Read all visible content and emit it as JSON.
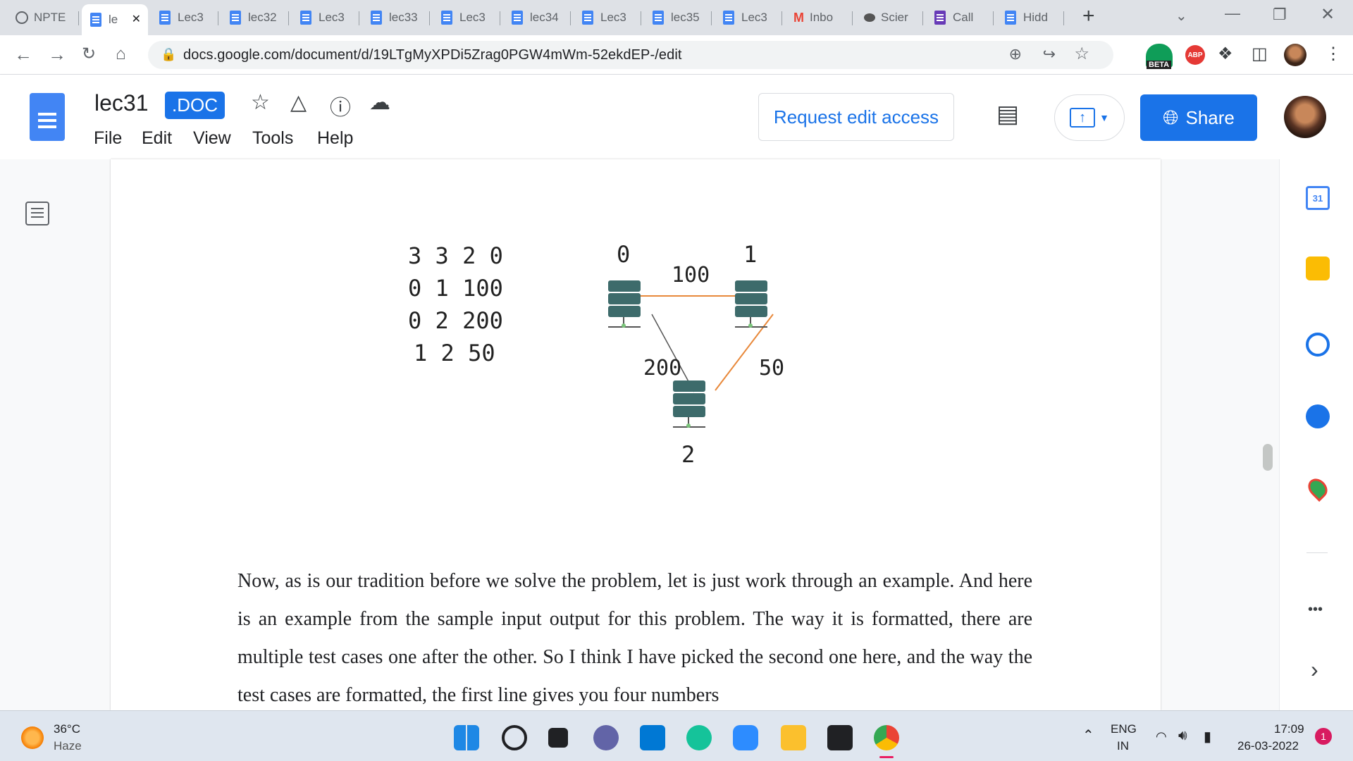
{
  "browser": {
    "tabs": [
      {
        "label": "NPTE",
        "icon": "globe-icon"
      },
      {
        "label": "le",
        "icon": "docs-icon",
        "active": true
      },
      {
        "label": "Lec3",
        "icon": "docs-icon"
      },
      {
        "label": "lec32",
        "icon": "docs-icon"
      },
      {
        "label": "Lec3",
        "icon": "docs-icon"
      },
      {
        "label": "lec33",
        "icon": "docs-icon"
      },
      {
        "label": "Lec3",
        "icon": "docs-icon"
      },
      {
        "label": "lec34",
        "icon": "docs-icon"
      },
      {
        "label": "Lec3",
        "icon": "docs-icon"
      },
      {
        "label": "lec35",
        "icon": "docs-icon"
      },
      {
        "label": "Lec3",
        "icon": "docs-icon"
      },
      {
        "label": "Inbo",
        "icon": "gmail-icon"
      },
      {
        "label": "Scier",
        "icon": "science-icon"
      },
      {
        "label": "Call",
        "icon": "forms-icon"
      },
      {
        "label": "Hidd",
        "icon": "docs-icon"
      }
    ],
    "new_tab": "+",
    "url": "docs.google.com/document/d/19LTgMyXPDi5Zrag0PGW4mWm-52ekdEP-/edit",
    "beta_label": "BETA",
    "abp_label": "ABP"
  },
  "docs": {
    "title": "lec31",
    "badge": ".DOC",
    "menu": [
      "File",
      "Edit",
      "View",
      "Tools",
      "Help"
    ],
    "request_edit": "Request edit access",
    "share": "Share"
  },
  "figure": {
    "input_lines": [
      "3 3 2 0",
      "0 1 100",
      "0 2 200",
      "1 2 50"
    ],
    "nodes": [
      {
        "id": "0",
        "label": "0"
      },
      {
        "id": "1",
        "label": "1"
      },
      {
        "id": "2",
        "label": "2"
      }
    ],
    "edges": [
      {
        "from": "0",
        "to": "1",
        "weight": "100",
        "color": "#e8883a"
      },
      {
        "from": "0",
        "to": "2",
        "weight": "200",
        "color": "#555555"
      },
      {
        "from": "1",
        "to": "2",
        "weight": "50",
        "color": "#e8883a"
      }
    ]
  },
  "paragraph": "Now, as is our tradition before we solve the problem, let is just work through an example. And here is an example from the sample input output for this problem. The way it is formatted, there are multiple test cases one after the other. So I think I have picked the second one here, and the way the test cases are formatted, the first line gives you four numbers",
  "side_panel": {
    "calendar_day": "31",
    "more": "•••",
    "expand": "›"
  },
  "taskbar": {
    "weather_temp": "36°C",
    "weather_desc": "Haze",
    "lang": "ENG",
    "region": "IN",
    "time": "17:09",
    "date": "26-03-2022",
    "notifications": "1"
  }
}
